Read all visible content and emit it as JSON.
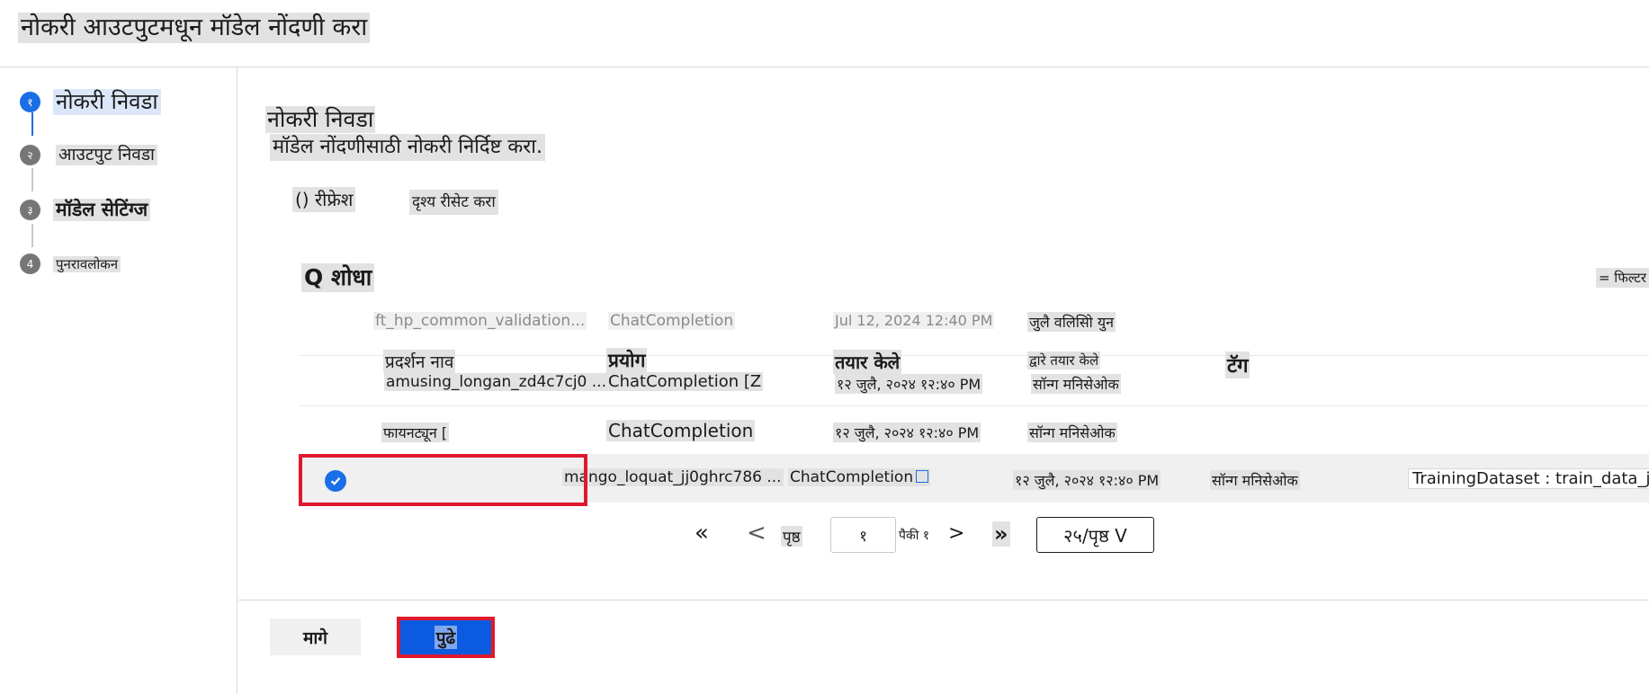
{
  "header": {
    "title": "नोकरी आउटपुटमधून मॉडेल नोंदणी करा"
  },
  "steps": [
    {
      "num": "१",
      "label": "नोकरी निवडा"
    },
    {
      "num": "२",
      "label": "आउटपुट निवडा"
    },
    {
      "num": "३",
      "label": "मॉडेल सेटिंग्ज"
    },
    {
      "num": "4",
      "label": "पुनरावलोकन"
    }
  ],
  "section": {
    "title": "नोकरी निवडा",
    "description": "मॉडेल नोंदणीसाठी नोकरी निर्दिष्ट करा."
  },
  "toolbar": {
    "refresh": "() रीफ्रेश",
    "reset_view": "दृश्य रीसेट करा"
  },
  "search": {
    "label": "Q शोधा"
  },
  "filter": {
    "label": "= फिल्टर"
  },
  "ghost_row": {
    "name": "ft_hp_common_validation...",
    "experiment": "ChatCompletion",
    "created": "Jul 12, 2024 12:40 PM",
    "created_by": "जुलै वलिसिो युन"
  },
  "columns": {
    "name": "प्रदर्शन नाव",
    "experiment": "प्रयोग",
    "created": "तयार केले",
    "created_by": "द्वारे तयार केले",
    "tags": "टॅग"
  },
  "rows": [
    {
      "name": "amusing_longan_zd4c7cj0 ...",
      "experiment": "ChatCompletion [Z",
      "created": "१२ जुलै, २०२४ १२:४० PM",
      "created_by": "सॉन्ग मनिसेओक",
      "tags": ""
    },
    {
      "name": "फायनट्यून [",
      "experiment": "ChatCompletion",
      "created": "१२ जुलै, २०२४ १२:४० PM",
      "created_by": "सॉन्ग मनिसेओक",
      "tags": ""
    },
    {
      "name": "mango_loquat_jj0ghrc786 ...",
      "experiment": "ChatCompletion",
      "created": "१२ जुलै, २०२४ १२:४० PM",
      "created_by": "सॉन्ग मनिसेओक",
      "tags": "TrainingDataset : train_data_jsonl"
    }
  ],
  "pager": {
    "first": "«",
    "prev": "<",
    "page_label": "पृष्ठ",
    "page_value": "१",
    "of_label": "पैकी १",
    "next": ">",
    "last": "»",
    "page_size": "२५/पृष्ठ V"
  },
  "footer": {
    "back": "मागे",
    "next": "पुढे"
  },
  "colors": {
    "accent": "#1a6ee6",
    "selection_outline": "#e0192d",
    "primary_button": "#0c5ae0"
  },
  "icons": {
    "check": "checkmark-circle-icon",
    "external_link": "external-link-icon"
  }
}
